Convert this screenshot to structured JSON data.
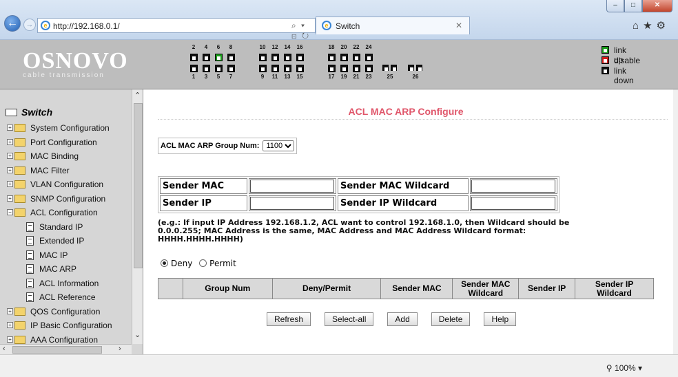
{
  "browser": {
    "url": "http://192.168.0.1/",
    "tab_title": "Switch",
    "search_glyph": "⌕ ▾ ⊡ ↻",
    "zoom": "100%"
  },
  "header": {
    "logo_name": "OSNOVO",
    "logo_tagline": "cable transmission",
    "top_ports": [
      "2",
      "4",
      "6",
      "8",
      "10",
      "12",
      "14",
      "16",
      "18",
      "20",
      "22",
      "24"
    ],
    "bottom_ports": [
      "1",
      "3",
      "5",
      "7",
      "9",
      "11",
      "13",
      "15",
      "17",
      "19",
      "21",
      "23"
    ],
    "extra_ports": [
      "25",
      "26"
    ],
    "legend": {
      "up": "link up",
      "disable": "disable",
      "down": "link down"
    }
  },
  "sidebar": {
    "root": "Switch",
    "items": [
      {
        "label": "System Configuration"
      },
      {
        "label": "Port Configuration"
      },
      {
        "label": "MAC Binding"
      },
      {
        "label": "MAC Filter"
      },
      {
        "label": "VLAN Configuration"
      },
      {
        "label": "SNMP Configuration"
      },
      {
        "label": "ACL Configuration"
      }
    ],
    "acl_children": [
      {
        "label": "Standard IP"
      },
      {
        "label": "Extended IP"
      },
      {
        "label": "MAC IP"
      },
      {
        "label": "MAC ARP"
      },
      {
        "label": "ACL Information"
      },
      {
        "label": "ACL Reference"
      }
    ],
    "items_after": [
      {
        "label": "QOS Configuration"
      },
      {
        "label": "IP Basic Configuration"
      },
      {
        "label": "AAA Configuration"
      }
    ]
  },
  "main": {
    "title": "ACL MAC ARP Configure",
    "group_label": "ACL MAC ARP Group Num:",
    "group_value": "1100",
    "fields": {
      "sender_mac": "Sender MAC",
      "sender_mac_wildcard": "Sender MAC Wildcard",
      "sender_ip": "Sender IP",
      "sender_ip_wildcard": "Sender IP Wildcard"
    },
    "note": "(e.g.: If input IP Address 192.168.1.2, ACL want to control 192.168.1.0, then Wildcard should be 0.0.0.255; MAC Address is the same, MAC Address and MAC Address Wildcard format: HHHH.HHHH.HHHH)",
    "radio_deny": "Deny",
    "radio_permit": "Permit",
    "table_headers": [
      "",
      "Group Num",
      "Deny/Permit",
      "Sender MAC",
      "Sender MAC Wildcard",
      "Sender IP",
      "Sender IP Wildcard"
    ],
    "buttons": {
      "refresh": "Refresh",
      "select_all": "Select-all",
      "add": "Add",
      "delete": "Delete",
      "help": "Help"
    }
  }
}
